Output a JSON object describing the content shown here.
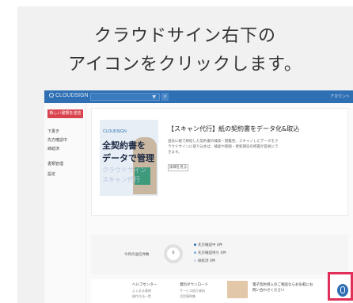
{
  "instruction": {
    "line1": "クラウドサイン右下の",
    "line2": "アイコンをクリックします。"
  },
  "app": {
    "logo": "CLOUDSIGN",
    "search_dropdown_arrow": "▼",
    "search_icon": "search-icon",
    "top_right_label": "アカウント",
    "sidebar": {
      "new_button": "新しい書類を送信",
      "items": [
        "下書き",
        "先方確認中",
        "締結済",
        "書類管理",
        "設定"
      ]
    },
    "banner": {
      "promo_brand": "CLOUDSIGN",
      "promo_line1": "全契約書を",
      "promo_line2": "データで管理",
      "promo_line3": "クラウドサイン",
      "promo_line4": "スキャン代行",
      "title": "【スキャン代行】紙の契約書をデータ化&取込",
      "description": "過去に紙で締結した契約書の検索・閲覧性、スキャンしたデータをクラウドサインに取り込めば、検索や期限・更新期日の把握が容易にできます。",
      "detail_button": "詳細を見る"
    },
    "stats": {
      "label": "今月の送信件数",
      "donut_value": "0",
      "legend": [
        {
          "label": "先方確認中",
          "value": "0件",
          "color": "#2f6fb4"
        },
        {
          "label": "先方確認待ち",
          "value": "0件",
          "color": "#7fb0e0"
        },
        {
          "label": "締結済",
          "value": "0件",
          "color": "#c9d9ea"
        }
      ]
    },
    "footer": {
      "help_heading_1": "ヘルプセンター",
      "help_heading_2": "資料ダウンロード",
      "help_lines_1": [
        "よくある質問",
        "操作方法一覧"
      ],
      "help_lines_2": [
        "サービス紹介資料",
        "活用事例集"
      ],
      "news_text": "電子契約導入のご相談ならお気軽にお問い合わせください"
    },
    "chat_icon": "chat-bubble-icon"
  },
  "colors": {
    "brand_blue": "#2f6fb4",
    "new_button_red": "#d9434d",
    "highlight_pink": "#e0305a"
  }
}
